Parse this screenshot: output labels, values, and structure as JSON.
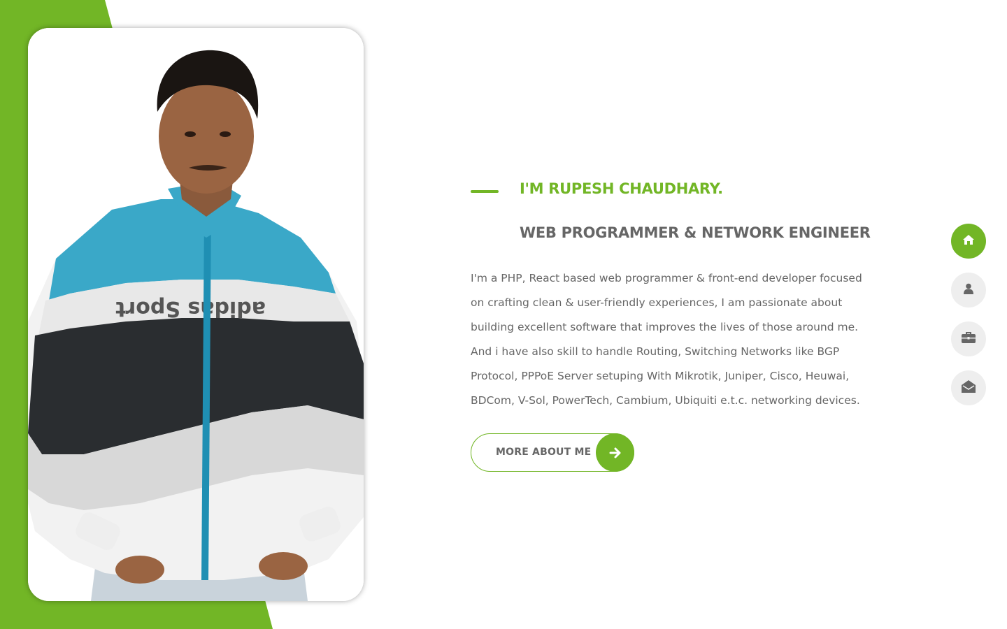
{
  "colors": {
    "accent": "#72b626",
    "text": "#666666",
    "nav_inactive_bg": "#eeeeee",
    "background": "#ffffff"
  },
  "hero": {
    "title_primary": "I'M RUPESH CHAUDHARY.",
    "title_secondary": "WEB PROGRAMMER & NETWORK ENGINEER",
    "description": "I'm a PHP, React based web programmer & front-end developer focused on crafting clean & user-friendly experiences, I am passionate about building excellent software that improves the lives of those around me. And i have also skill to handle Routing, Switching Networks like BGP Protocol, PPPoE Server setuping With Mikrotik, Juniper, Cisco, Heuwai, BDCom, V-Sol, PowerTech, Cambium, Ubiquiti e.t.c. networking devices.",
    "button_label": "MORE ABOUT ME",
    "button_icon": "arrow-right-icon",
    "photo_subject": "profile-photo"
  },
  "nav": {
    "items": [
      {
        "icon": "home-icon",
        "active": true
      },
      {
        "icon": "user-icon",
        "active": false
      },
      {
        "icon": "briefcase-icon",
        "active": false
      },
      {
        "icon": "envelope-open-icon",
        "active": false
      }
    ]
  }
}
